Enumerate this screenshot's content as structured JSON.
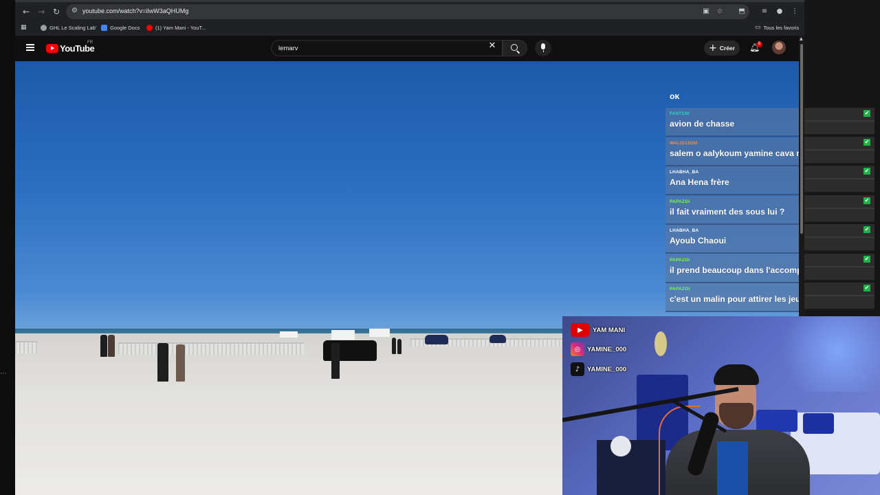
{
  "browser": {
    "url": "youtube.com/watch?v=iIwW3aQHUMg",
    "bookmarks": [
      {
        "label": "GHL Le Scaling Lab'",
        "color": "#9aa0a6"
      },
      {
        "label": "Google Docs",
        "color": "#4285f4"
      },
      {
        "label": "(1) Yam Mani - YouT...",
        "color": "#ff0000"
      }
    ],
    "all_bookmarks_label": "Tous les favoris"
  },
  "youtube": {
    "logo_text": "YouTube",
    "region": "FR",
    "search_query": "lemarv",
    "create_label": "Créer",
    "notification_count": "6"
  },
  "chat": {
    "partial_top": "ok",
    "messages": [
      {
        "user": "FAST130",
        "user_color": "#2fd8c4",
        "text": "avion de chasse"
      },
      {
        "user": "WALID13OM",
        "user_color": "#ff8a3d",
        "text": "salem o aalykoum yamine cava mon frère"
      },
      {
        "user": "LHABHA_BA",
        "user_color": "#ffffff",
        "text": "Ana Hena frère"
      },
      {
        "user": "PAPAZGI",
        "user_color": "#7bff3a",
        "text": "il fait vraiment des sous lui ?"
      },
      {
        "user": "LHABHA_BA",
        "user_color": "#ffffff",
        "text": "Ayoub Chaoui"
      },
      {
        "user": "PAPAZGI",
        "user_color": "#7bff3a",
        "text": "il prend beaucoup dans l'accompagnement"
      },
      {
        "user": "PAPAZGI",
        "user_color": "#7bff3a",
        "text": "c'est un malin pour attirer les jeune sa"
      }
    ]
  },
  "socials": [
    {
      "platform": "youtube-icon",
      "name": "YAM MANI"
    },
    {
      "platform": "instagram-icon",
      "name": "YAMINE_000"
    },
    {
      "platform": "tiktok-icon",
      "name": "YAMINE_000"
    }
  ]
}
